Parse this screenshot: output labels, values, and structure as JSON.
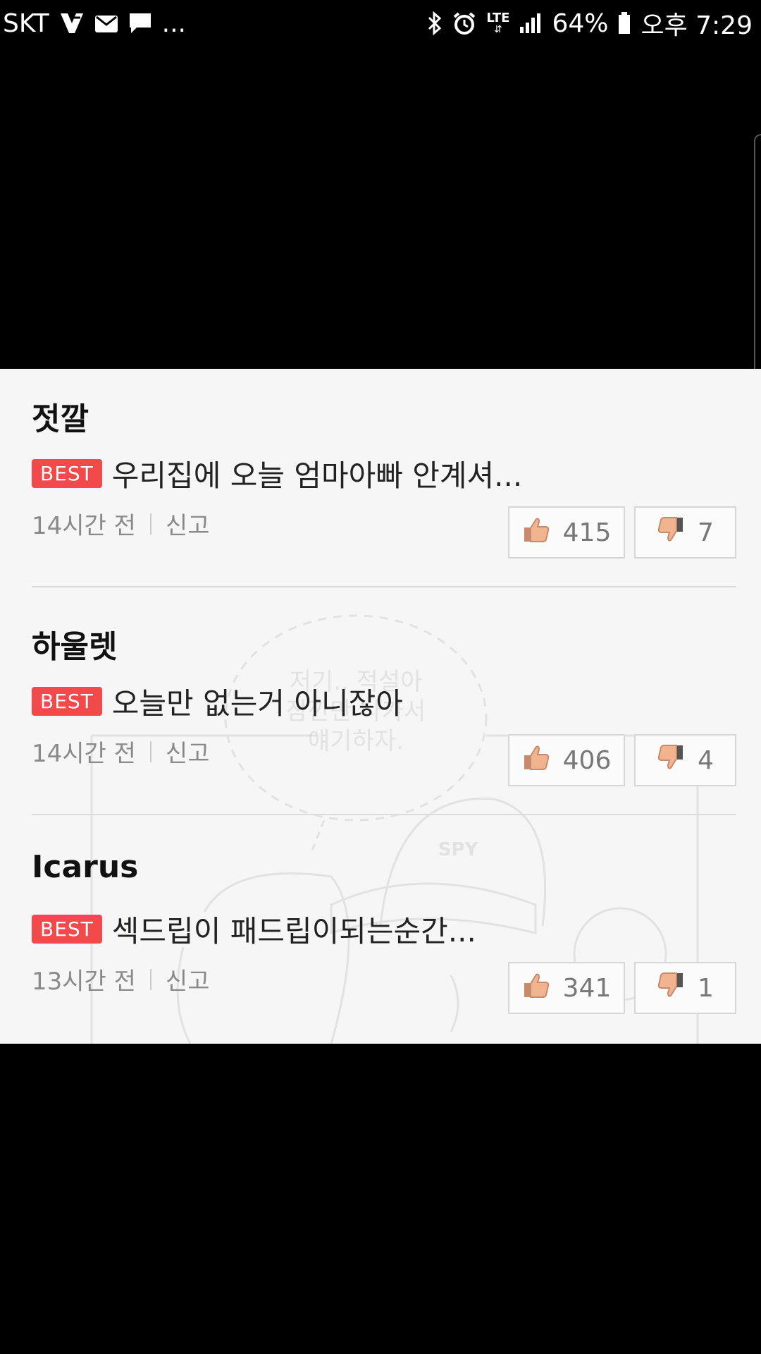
{
  "status_bar": {
    "carrier": "SKT",
    "battery": "64%",
    "time": "오후 7:29",
    "network": "LTE",
    "more": "..."
  },
  "comments": [
    {
      "user": "젓깔",
      "badge": "BEST",
      "text": "우리집에 오늘 엄마아빠 안계셔...",
      "time": "14시간 전",
      "report": "신고",
      "likes": "415",
      "dislikes": "7"
    },
    {
      "user": "하울렛",
      "badge": "BEST",
      "text": "오늘만 없는거 아니잖아",
      "time": "14시간 전",
      "report": "신고",
      "likes": "406",
      "dislikes": "4"
    },
    {
      "user": "Icarus",
      "badge": "BEST",
      "text": "섹드립이 패드립이되는순간...",
      "time": "13시간 전",
      "report": "신고",
      "likes": "341",
      "dislikes": "1"
    }
  ],
  "background_art": {
    "speech_bubble": "저기.. 적설아 잠깐만 나가서 얘기하자.",
    "cap_text": "SPY"
  }
}
